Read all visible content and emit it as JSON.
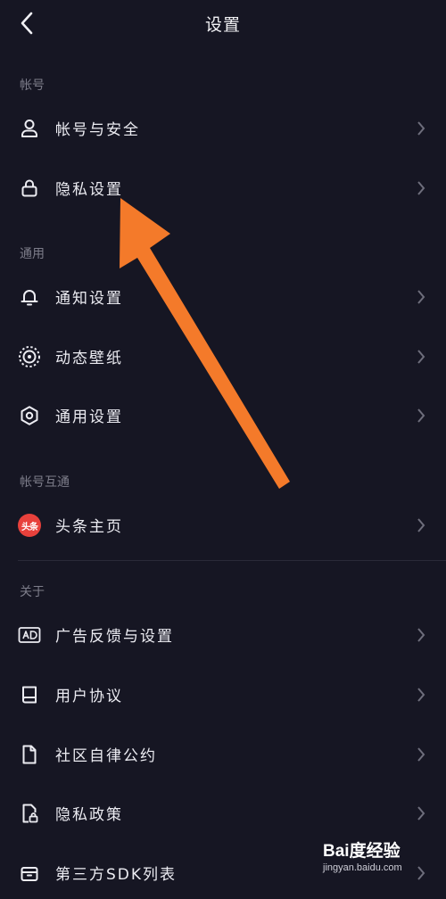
{
  "header": {
    "title": "设置"
  },
  "sections": {
    "account": "帐号",
    "general": "通用",
    "interop": "帐号互通",
    "about": "关于"
  },
  "items": {
    "account_security": "帐号与安全",
    "privacy_settings": "隐私设置",
    "notification_settings": "通知设置",
    "live_wallpaper": "动态壁纸",
    "general_settings": "通用设置",
    "toutiao_home": "头条主页",
    "toutiao_badge": "头条",
    "ad_feedback": "广告反馈与设置",
    "user_agreement": "用户协议",
    "community_rules": "社区自律公约",
    "privacy_policy": "隐私政策",
    "third_party_sdk": "第三方SDK列表"
  },
  "icons": {
    "back": "chevron-left-icon",
    "account_security": "person-icon",
    "privacy_settings": "lock-icon",
    "notification_settings": "bell-icon",
    "live_wallpaper": "wallpaper-icon",
    "general_settings": "gear-icon",
    "ad_feedback": "ad-icon",
    "user_agreement": "book-icon",
    "community_rules": "document-icon",
    "privacy_policy": "document-lock-icon",
    "third_party_sdk": "box-icon",
    "row_chevron": "chevron-right-icon"
  },
  "watermark": {
    "brand": "Bai度经验",
    "url": "jingyan.baidu.com"
  },
  "colors": {
    "background": "#161623",
    "arrow": "#f47a2a",
    "badge": "#e8413c"
  }
}
